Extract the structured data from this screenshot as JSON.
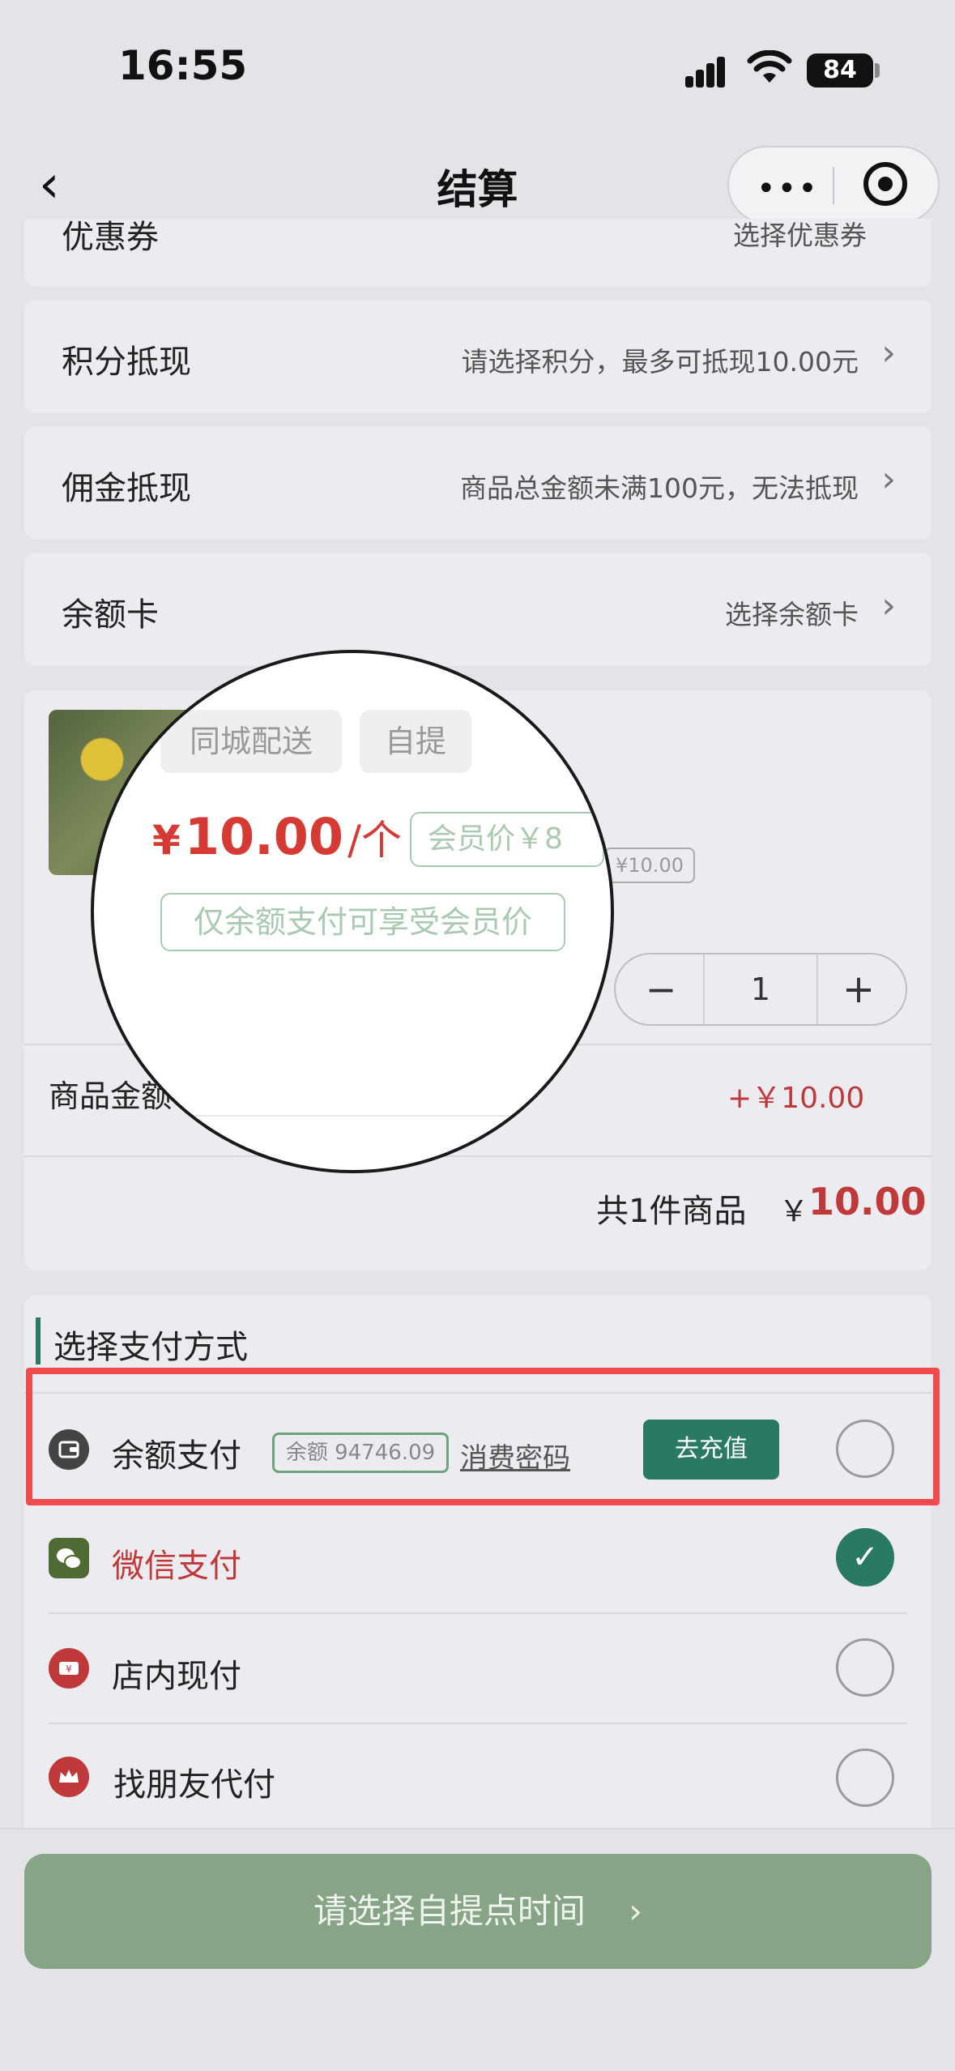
{
  "status": {
    "time": "16:55",
    "battery": "84"
  },
  "nav": {
    "title": "结算",
    "back_icon": "‹",
    "more_icon": "•••"
  },
  "rows": {
    "coupon": {
      "label": "优惠券",
      "value": "选择优惠券"
    },
    "points": {
      "label": "积分抵现",
      "value": "请选择积分，最多可抵现10.00元"
    },
    "commission": {
      "label": "佣金抵现",
      "value": "商品总金额未满100元，无法抵现"
    },
    "balance_card": {
      "label": "余额卡",
      "value": "选择余额卡"
    },
    "chevron": "›"
  },
  "product": {
    "delivery_tags": [
      "同城配送",
      "自提"
    ],
    "price_symbol": "¥",
    "price": "10.00",
    "unit": "/个",
    "member_price": "会员价￥8",
    "original_price_tag": "¥10.00",
    "member_note": "仅余额支付可享受会员价",
    "quantity": "1",
    "minus": "−",
    "plus": "+"
  },
  "summary": {
    "goods_amount_label": "商品金额",
    "goods_amount_value": "+￥10.00",
    "total_prefix": "共1件商品",
    "total_symbol": "￥",
    "total_value": "10.00"
  },
  "payment": {
    "section_title": "选择支付方式",
    "balance": {
      "label": "余额支付",
      "chip": "余额 94746.09",
      "password_link": "消费密码",
      "recharge": "去充值"
    },
    "wechat": {
      "label": "微信支付",
      "check": "✓"
    },
    "in_store": {
      "label": "店内现付"
    },
    "friend": {
      "label": "找朋友代付"
    }
  },
  "submit": {
    "label": "请选择自提点时间",
    "chevron": "›"
  },
  "colors": {
    "accent": "#2a7a63",
    "price_red": "#d63a35",
    "highlight": "#ef4b4f",
    "submit_bg": "#87a486"
  },
  "icons": [
    "back-icon",
    "more-dots-icon",
    "target-icon",
    "wallet-icon",
    "wechat-icon",
    "cash-icon",
    "crown-icon",
    "check-icon",
    "chevron-right-icon"
  ]
}
